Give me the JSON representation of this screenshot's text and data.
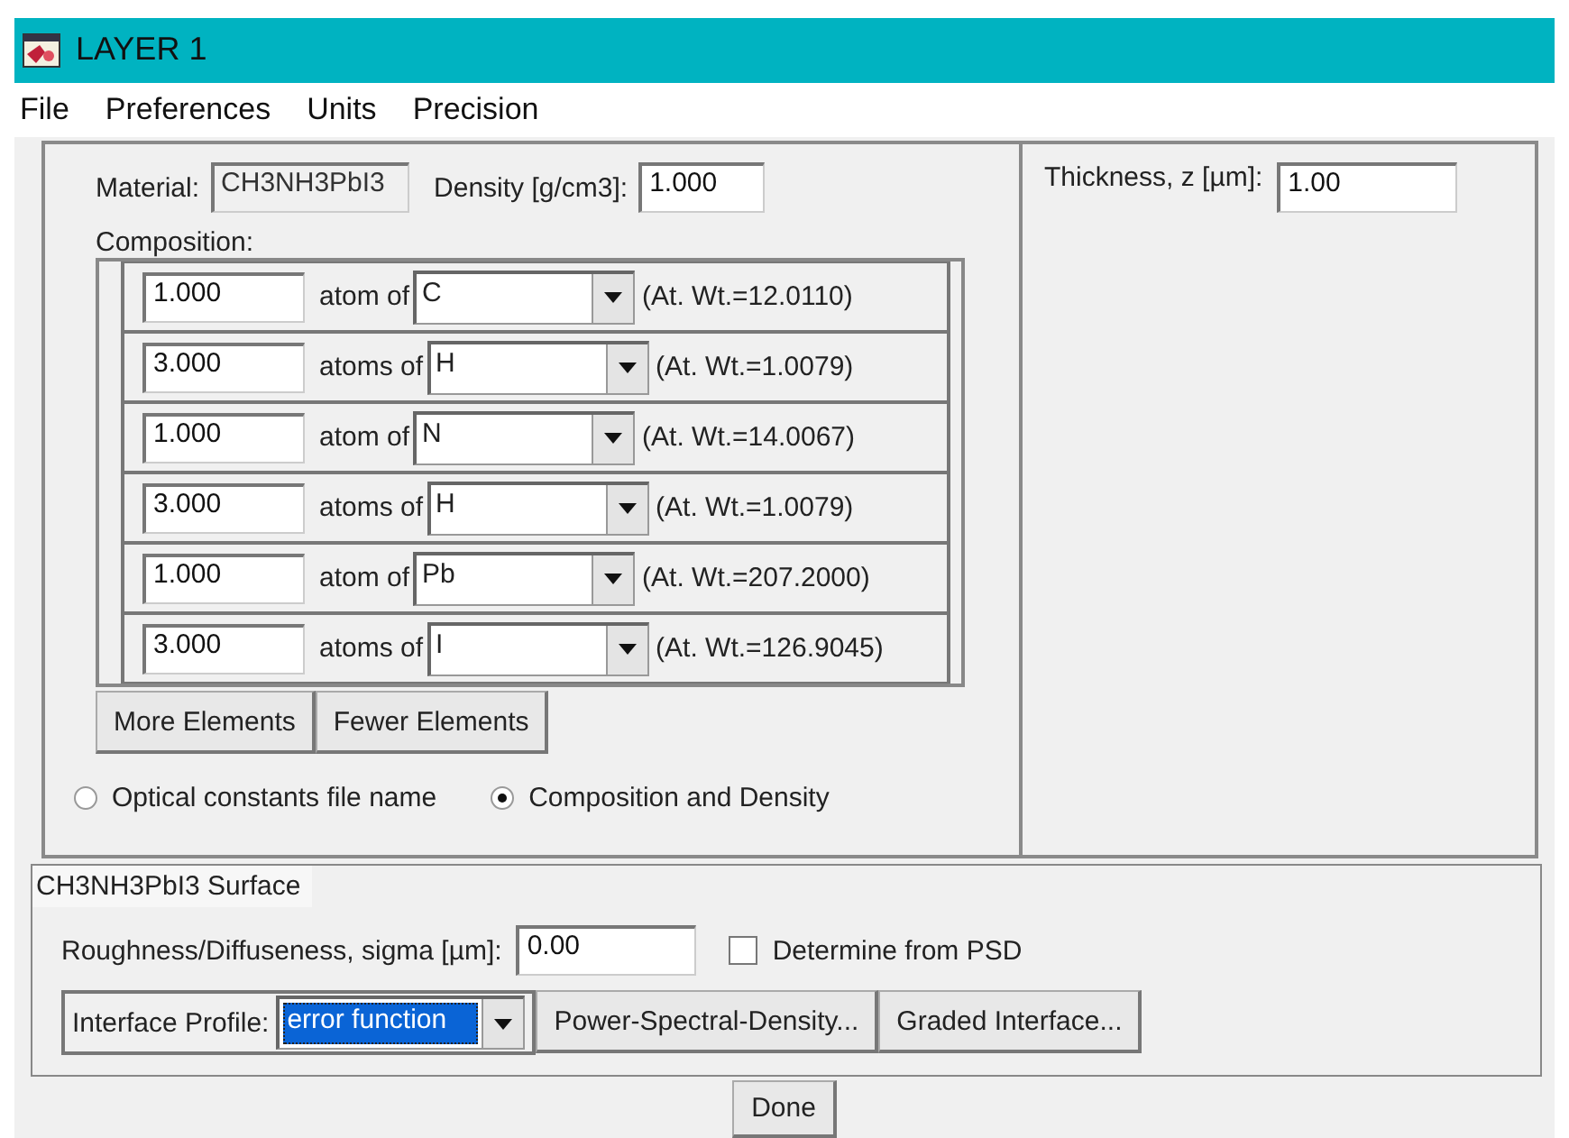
{
  "window": {
    "title": "LAYER 1"
  },
  "menu": [
    "File",
    "Preferences",
    "Units",
    "Precision"
  ],
  "material": {
    "label": "Material:",
    "value": "CH3NH3PbI3"
  },
  "density": {
    "label": "Density [g/cm3]:",
    "value": "1.000"
  },
  "thickness": {
    "label": "Thickness, z [µm]:",
    "value": "1.00"
  },
  "composition": {
    "label": "Composition:",
    "rows": [
      {
        "amount": "1.000",
        "unit": "atom of",
        "element": "C",
        "weight": "(At. Wt.=12.0110)"
      },
      {
        "amount": "3.000",
        "unit": "atoms of",
        "element": "H",
        "weight": "(At. Wt.=1.0079)"
      },
      {
        "amount": "1.000",
        "unit": "atom of",
        "element": "N",
        "weight": "(At. Wt.=14.0067)"
      },
      {
        "amount": "3.000",
        "unit": "atoms of",
        "element": "H",
        "weight": "(At. Wt.=1.0079)"
      },
      {
        "amount": "1.000",
        "unit": "atom of",
        "element": "Pb",
        "weight": "(At. Wt.=207.2000)"
      },
      {
        "amount": "3.000",
        "unit": "atoms of",
        "element": "I",
        "weight": "(At. Wt.=126.9045)"
      }
    ]
  },
  "element_buttons": [
    "More Elements",
    "Fewer Elements"
  ],
  "source_options": [
    {
      "label": "Optical constants file name",
      "selected": false
    },
    {
      "label": "Composition and Density",
      "selected": true
    }
  ],
  "surface": {
    "title": "CH3NH3PbI3 Surface",
    "roughness": {
      "label": "Roughness/Diffuseness, sigma [µm]:",
      "value": "0.00"
    },
    "determine": {
      "label": "Determine from PSD",
      "checked": false
    },
    "profile": {
      "label": "Interface Profile:",
      "value": "error function",
      "highlighted": true
    },
    "buttons": [
      "Power-Spectral-Density...",
      "Graded Interface..."
    ]
  },
  "done": "Done"
}
